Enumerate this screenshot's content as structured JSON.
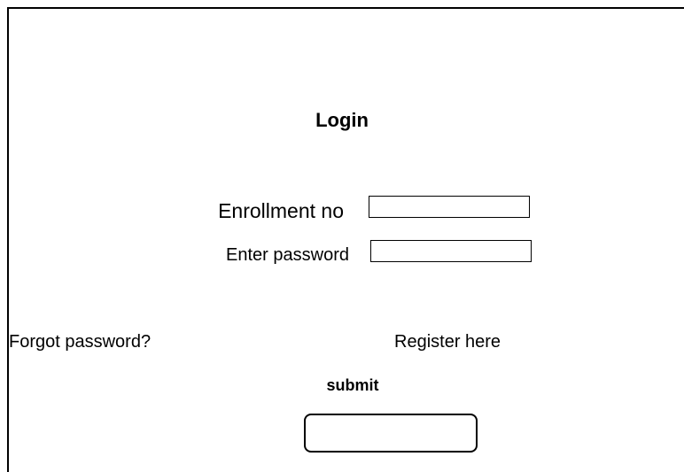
{
  "login_form": {
    "title": "Login",
    "enrollment": {
      "label": "Enrollment no",
      "value": ""
    },
    "password": {
      "label": "Enter password",
      "value": ""
    },
    "forgot_password_link": "Forgot password?",
    "register_link": "Register here",
    "submit_label": "submit"
  }
}
